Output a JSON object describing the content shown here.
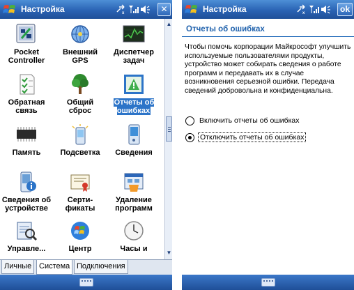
{
  "left": {
    "title": "Настройка",
    "close_label": "✕",
    "grid": [
      {
        "label": "Pocket Controller",
        "icon": "pocket-controller-icon"
      },
      {
        "label": "Внешний GPS",
        "icon": "gps-icon"
      },
      {
        "label": "Диспетчер задач",
        "icon": "task-manager-icon"
      },
      {
        "label": "Обратная связь",
        "icon": "feedback-icon"
      },
      {
        "label": "Общий сброс",
        "icon": "reset-tree-icon"
      },
      {
        "label": "Отчеты об ошибках",
        "icon": "error-report-icon",
        "selected": true
      },
      {
        "label": "Память",
        "icon": "memory-chip-icon"
      },
      {
        "label": "Подсветка",
        "icon": "backlight-icon"
      },
      {
        "label": "Сведения",
        "icon": "info-icon"
      },
      {
        "label": "Сведения об устройстве",
        "icon": "device-info-icon"
      },
      {
        "label": "Серти- фикаты",
        "icon": "certificates-icon"
      },
      {
        "label": "Удаление программ",
        "icon": "remove-programs-icon"
      },
      {
        "label": "Управле...",
        "icon": "manage-icon"
      },
      {
        "label": "Центр",
        "icon": "windows-center-icon"
      },
      {
        "label": "Часы и",
        "icon": "clock-icon"
      }
    ],
    "tabs": [
      "Личные",
      "Система",
      "Подключения"
    ],
    "active_tab": "Система"
  },
  "right": {
    "title": "Настройка",
    "ok_label": "ok",
    "header": "Отчеты об ошибках",
    "description": "Чтобы помочь корпорации Майкрософт улучшить используемые пользователями продукты, устройство может собирать сведения о работе программ и передавать их в случае возникновения серьезной ошибки. Передача сведений добровольна и конфиденциальна.",
    "options": [
      {
        "label": "Включить отчеты об ошибках",
        "checked": false
      },
      {
        "label": "Отключить отчеты об ошибках",
        "checked": true
      }
    ]
  },
  "colors": {
    "titlebar": "#2a63b4",
    "accent": "#2062ad",
    "selection": "#2c74c8"
  }
}
